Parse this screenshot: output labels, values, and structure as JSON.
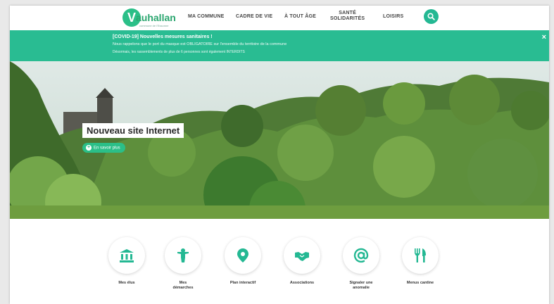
{
  "header": {
    "logo_letter": "V",
    "logo_name": "auhallan",
    "logo_tagline": "commune de l'Essonne",
    "nav": [
      {
        "label": "MA COMMUNE"
      },
      {
        "label": "CADRE DE VIE"
      },
      {
        "label": "À TOUT ÂGE"
      },
      {
        "label": "SANTÉ\nSOLIDARITÉS"
      },
      {
        "label": "LOISIRS"
      }
    ],
    "search_icon": "search-icon"
  },
  "alert": {
    "title": "[COVID-19] Nouvelles mesures sanitaires !",
    "line1": "Nous rappelons que le port du masque est OBLIGATOIRE sur l'ensemble du territoire de la commune",
    "line2": "Désormais, les rassemblements de plus de 6 personnes sont également INTERDITS",
    "close": "×",
    "color": "#29bc92"
  },
  "hero": {
    "title": "Nouveau site Internet",
    "button_icon": "+",
    "button_label": "En savoir plus"
  },
  "quick_links": [
    {
      "label": "Mes élus",
      "icon": "institution-icon"
    },
    {
      "label": "Mes\ndémarches",
      "icon": "person-icon"
    },
    {
      "label": "Plan interactif",
      "icon": "map-pin-icon"
    },
    {
      "label": "Associations",
      "icon": "handshake-icon"
    },
    {
      "label": "Signaler une\nanomalie",
      "icon": "at-icon"
    },
    {
      "label": "Menus cantine",
      "icon": "cutlery-icon"
    }
  ],
  "colors": {
    "accent": "#2bbf88",
    "icon": "#24b893"
  }
}
